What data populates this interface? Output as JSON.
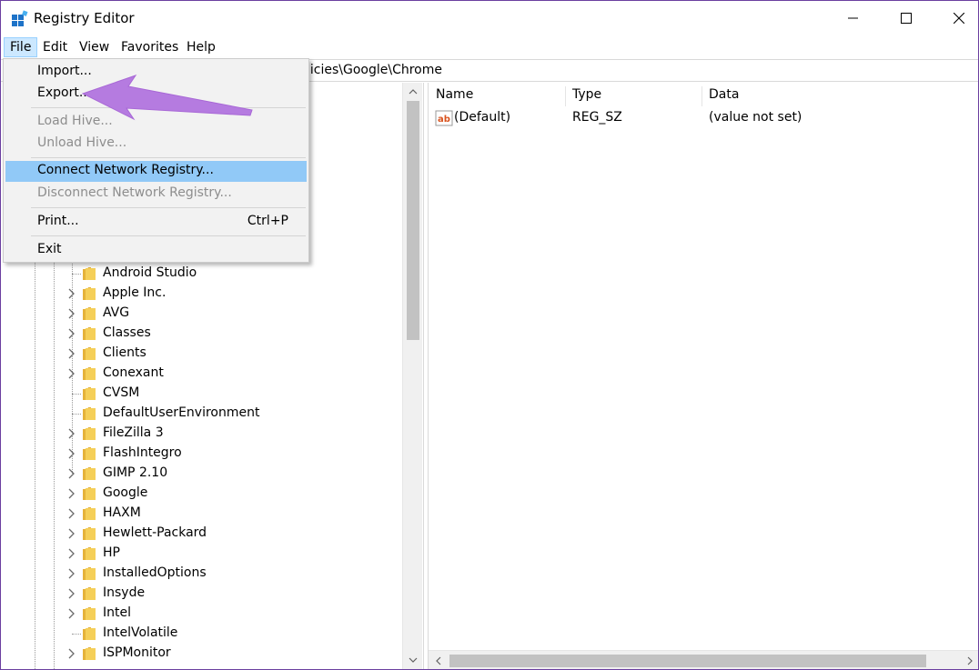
{
  "window": {
    "title": "Registry Editor"
  },
  "menubar": {
    "items": [
      "File",
      "Edit",
      "View",
      "Favorites",
      "Help"
    ]
  },
  "address": {
    "path": "licies\\Google\\Chrome"
  },
  "file_menu": {
    "import": "Import...",
    "export": "Export...",
    "load_hive": "Load Hive...",
    "unload_hive": "Unload Hive...",
    "connect": "Connect Network Registry...",
    "disconnect": "Disconnect Network Registry...",
    "print": "Print...",
    "print_shortcut": "Ctrl+P",
    "exit": "Exit"
  },
  "tree": {
    "items": [
      {
        "label": "Android Studio",
        "expandable": false
      },
      {
        "label": "Apple Inc.",
        "expandable": true
      },
      {
        "label": "AVG",
        "expandable": true
      },
      {
        "label": "Classes",
        "expandable": true
      },
      {
        "label": "Clients",
        "expandable": true
      },
      {
        "label": "Conexant",
        "expandable": true
      },
      {
        "label": "CVSM",
        "expandable": false
      },
      {
        "label": "DefaultUserEnvironment",
        "expandable": false
      },
      {
        "label": "FileZilla 3",
        "expandable": true
      },
      {
        "label": "FlashIntegro",
        "expandable": true
      },
      {
        "label": "GIMP 2.10",
        "expandable": true
      },
      {
        "label": "Google",
        "expandable": true
      },
      {
        "label": "HAXM",
        "expandable": true
      },
      {
        "label": "Hewlett-Packard",
        "expandable": true
      },
      {
        "label": "HP",
        "expandable": true
      },
      {
        "label": "InstalledOptions",
        "expandable": true
      },
      {
        "label": "Insyde",
        "expandable": true
      },
      {
        "label": "Intel",
        "expandable": true
      },
      {
        "label": "IntelVolatile",
        "expandable": false
      },
      {
        "label": "ISPMonitor",
        "expandable": true
      }
    ]
  },
  "values": {
    "columns": [
      "Name",
      "Type",
      "Data"
    ],
    "rows": [
      {
        "name": "(Default)",
        "type": "REG_SZ",
        "data": "(value not set)"
      }
    ]
  },
  "colors": {
    "menu_highlight": "#91c9f7",
    "menu_active": "#cce8ff",
    "arrow": "#b57be0",
    "folder": "#f5cf58",
    "window_border": "#6b3fa0"
  }
}
